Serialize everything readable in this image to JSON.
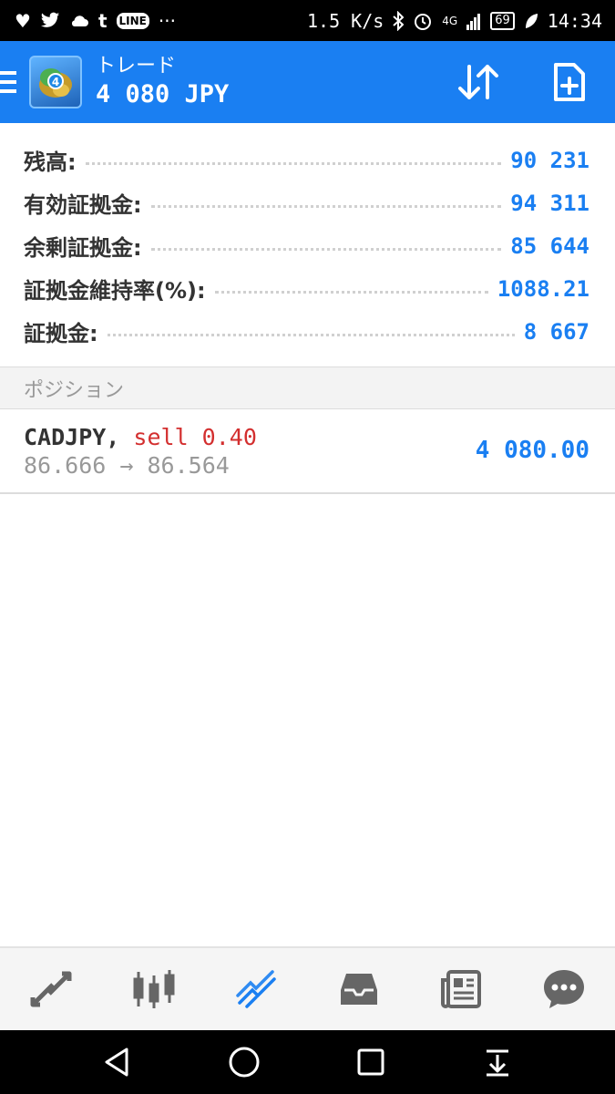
{
  "status_bar": {
    "speed": "1.5 K/s",
    "network": "4G",
    "battery": "69",
    "time": "14:34",
    "left_icons": [
      "heart-icon",
      "twitter-icon",
      "cloud-icon",
      "tumblr-icon",
      "line-icon",
      "more-icon"
    ],
    "line_label": "LINE"
  },
  "app_bar": {
    "title": "トレード",
    "subtitle": "4 080 JPY",
    "logo_badge": "4"
  },
  "summary": [
    {
      "label": "残高:",
      "value": "90 231"
    },
    {
      "label": "有効証拠金:",
      "value": "94 311"
    },
    {
      "label": "余剰証拠金:",
      "value": "85 644"
    },
    {
      "label": "証拠金維持率(%):",
      "value": "1088.21"
    },
    {
      "label": "証拠金:",
      "value": "8 667"
    }
  ],
  "positions_header": "ポジション",
  "position": {
    "symbol": "CADJPY,",
    "side_volume": "sell 0.40",
    "price_open": "86.666",
    "arrow": "→",
    "price_current": "86.564",
    "profit": "4 080.00"
  },
  "bottom_nav": [
    "quotes-icon",
    "chart-icon",
    "trade-icon",
    "history-icon",
    "news-icon",
    "chat-icon"
  ],
  "colors": {
    "accent": "#1a7ff2",
    "sell": "#d32f2f",
    "muted": "#999999"
  }
}
